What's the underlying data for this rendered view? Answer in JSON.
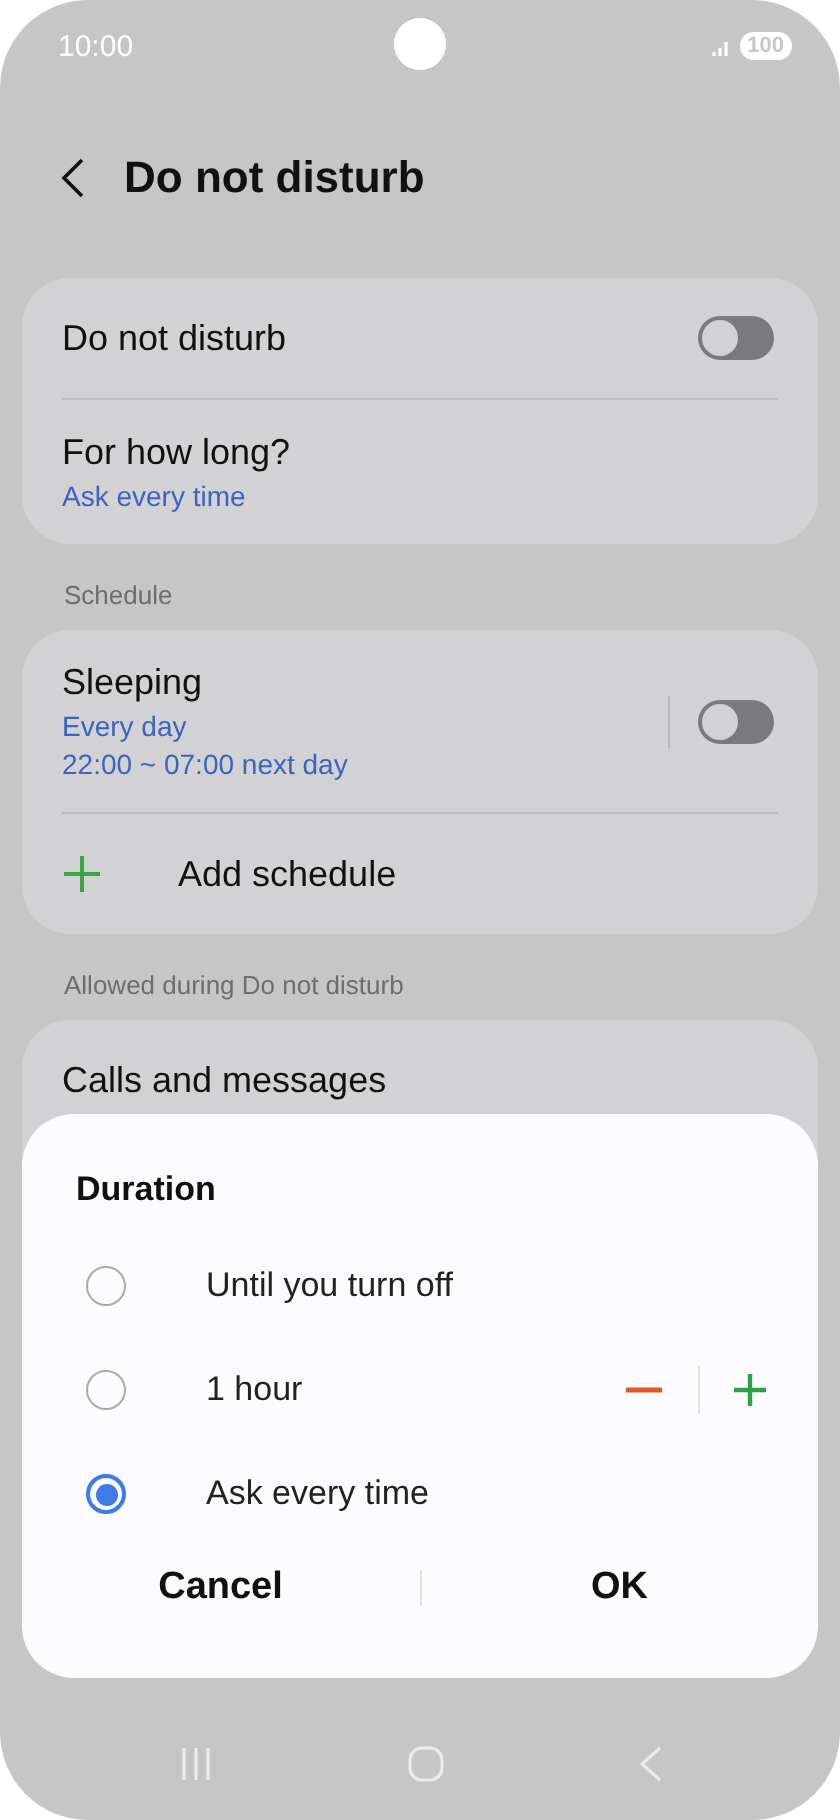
{
  "status_bar": {
    "time": "10:00",
    "battery": "100"
  },
  "header": {
    "title": "Do not disturb"
  },
  "main_card": [
    {
      "kind": "toggle",
      "title": "Do not disturb",
      "on": false
    },
    {
      "kind": "value",
      "title": "For how long?",
      "subtitles": [
        "Ask every time"
      ]
    }
  ],
  "schedule": {
    "label": "Schedule",
    "items": [
      {
        "kind": "toggle",
        "title": "Sleeping",
        "subtitles": [
          "Every day",
          "22:00 ~ 07:00 next day"
        ],
        "on": false
      },
      {
        "kind": "add",
        "title": "Add schedule"
      }
    ]
  },
  "allowed": {
    "label": "Allowed during Do not disturb",
    "items": [
      {
        "kind": "value",
        "title": "Calls and messages"
      }
    ]
  },
  "dialog": {
    "title": "Duration",
    "options": [
      {
        "label": "Until you turn off",
        "selected": false
      },
      {
        "label": "1 hour",
        "selected": false,
        "stepper": true
      },
      {
        "label": "Ask every time",
        "selected": true
      }
    ],
    "buttons": [
      "Cancel",
      "OK"
    ]
  }
}
